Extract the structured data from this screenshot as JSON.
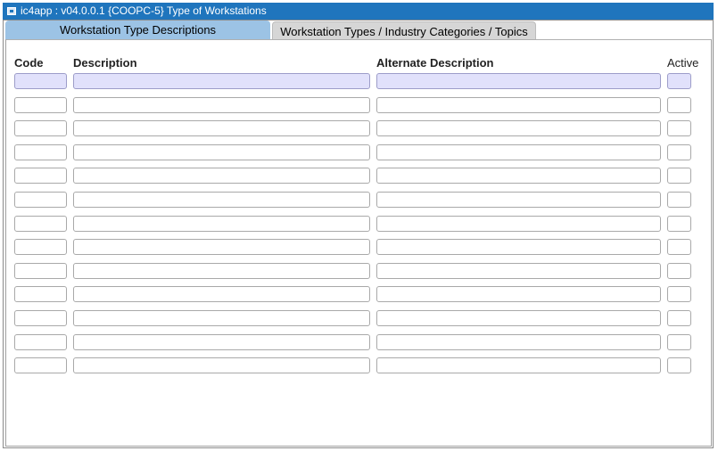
{
  "window": {
    "title": "ic4app : v04.0.0.1  {COOPC-5} Type of Workstations"
  },
  "tabs": [
    {
      "label": "Workstation Type Descriptions",
      "active": true
    },
    {
      "label": "Workstation Types / Industry Categories / Topics",
      "active": false
    }
  ],
  "grid": {
    "columns": {
      "code": "Code",
      "description": "Description",
      "alternate_description": "Alternate Description",
      "active": "Active"
    },
    "rows": [
      {
        "code": "",
        "description": "",
        "alternate_description": "",
        "active": "",
        "selected": true
      },
      {
        "code": "",
        "description": "",
        "alternate_description": "",
        "active": ""
      },
      {
        "code": "",
        "description": "",
        "alternate_description": "",
        "active": ""
      },
      {
        "code": "",
        "description": "",
        "alternate_description": "",
        "active": ""
      },
      {
        "code": "",
        "description": "",
        "alternate_description": "",
        "active": ""
      },
      {
        "code": "",
        "description": "",
        "alternate_description": "",
        "active": ""
      },
      {
        "code": "",
        "description": "",
        "alternate_description": "",
        "active": ""
      },
      {
        "code": "",
        "description": "",
        "alternate_description": "",
        "active": ""
      },
      {
        "code": "",
        "description": "",
        "alternate_description": "",
        "active": ""
      },
      {
        "code": "",
        "description": "",
        "alternate_description": "",
        "active": ""
      },
      {
        "code": "",
        "description": "",
        "alternate_description": "",
        "active": ""
      },
      {
        "code": "",
        "description": "",
        "alternate_description": "",
        "active": ""
      },
      {
        "code": "",
        "description": "",
        "alternate_description": "",
        "active": ""
      }
    ]
  },
  "colors": {
    "titlebar": "#1f75bd",
    "active_tab": "#9cc3e5",
    "selected_row": "#e1e1fb"
  }
}
